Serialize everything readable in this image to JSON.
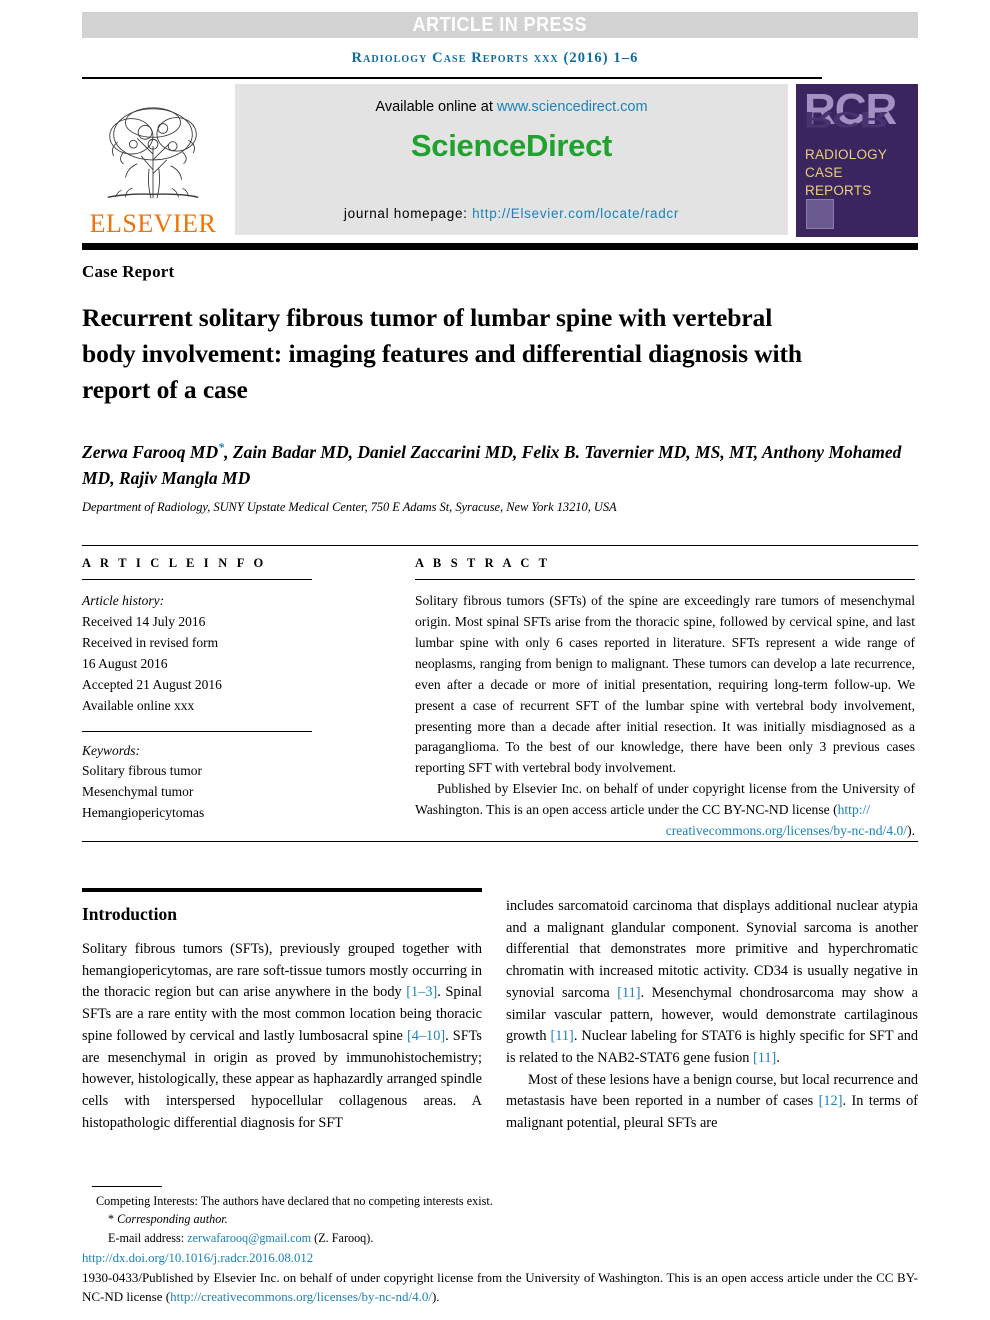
{
  "banner": {
    "text": "ARTICLE IN PRESS",
    "bg_color": "#d2d2d2",
    "text_color": "#ffffff"
  },
  "running_head": "Radiology Case Reports xxx (2016) 1–6",
  "masthead": {
    "publisher_name": "ELSEVIER",
    "publisher_color": "#ec7404",
    "available_label": "Available online at",
    "available_url": "www.sciencedirect.com",
    "sciencedirect_logo": "ScienceDirect",
    "sciencedirect_color": "#1fa22e",
    "homepage_label": "journal homepage:",
    "homepage_url": "http://Elsevier.com/locate/radcr",
    "link_color": "#2a79b5",
    "cover": {
      "acronym": "RCR",
      "line1": "RADIOLOGY",
      "line2": "CASE",
      "line3": "REPORTS",
      "bg_color": "#3b255f",
      "acronym_color": "#a491c4",
      "title_color": "#e8d07a"
    }
  },
  "article": {
    "type_label": "Case Report",
    "title": "Recurrent solitary fibrous tumor of lumbar spine with vertebral body involvement: imaging features and differential diagnosis with report of a case",
    "authors": "Zerwa Farooq MD",
    "authors_rest": ", Zain Badar MD, Daniel Zaccarini MD, Felix B. Tavernier MD, MS, MT, Anthony Mohamed MD, Rajiv Mangla MD",
    "corresponding_marker": "*",
    "affiliation": "Department of Radiology, SUNY Upstate Medical Center, 750 E Adams St, Syracuse, New York 13210, USA"
  },
  "article_info": {
    "heading": "A R T I C L E   I N F O",
    "history_label": "Article history:",
    "received": "Received 14 July 2016",
    "revised_label": "Received in revised form",
    "revised_date": "16 August 2016",
    "accepted": "Accepted 21 August 2016",
    "available_online": "Available online xxx",
    "keywords_label": "Keywords:",
    "keywords": [
      "Solitary fibrous tumor",
      "Mesenchymal tumor",
      "Hemangiopericytomas"
    ]
  },
  "abstract": {
    "heading": "A B S T R A C T",
    "body": "Solitary fibrous tumors (SFTs) of the spine are exceedingly rare tumors of mesenchymal origin. Most spinal SFTs arise from the thoracic spine, followed by cervical spine, and last lumbar spine with only 6 cases reported in literature. SFTs represent a wide range of neoplasms, ranging from benign to malignant. These tumors can develop a late recurrence, even after a decade or more of initial presentation, requiring long-term follow-up. We present a case of recurrent SFT of the lumbar spine with vertebral body involvement, presenting more than a decade after initial resection. It was initially misdiagnosed as a paraganglioma. To the best of our knowledge, there have been only 3 previous cases reporting SFT with vertebral body involvement.",
    "published_text": "Published by Elsevier Inc. on behalf of under copyright license from the University of Washington. This is an open access article under the CC BY-NC-ND license (",
    "license_url_part1": "http://",
    "license_url_part2": "creativecommons.org/licenses/by-nc-nd/4.0/",
    "published_tail": ")."
  },
  "introduction": {
    "heading": "Introduction",
    "left_paragraph_part1": "Solitary fibrous tumors (SFTs), previously grouped together with hemangiopericytomas, are rare soft-tissue tumors mostly occurring in the thoracic region but can arise anywhere in the body ",
    "ref_1_3": "[1–3]",
    "left_paragraph_part2": ". Spinal SFTs are a rare entity with the most common location being thoracic spine followed by cervical and lastly lumbosacral spine ",
    "ref_4_10": "[4–10]",
    "left_paragraph_part3": ". SFTs are mesenchymal in origin as proved by immunohistochemistry; however, histologically, these appear as haphazardly arranged spindle cells with interspersed hypocellular collagenous areas. A histopathologic differential diagnosis for SFT",
    "right_paragraph_part1": "includes sarcomatoid carcinoma that displays additional nuclear atypia and a malignant glandular component. Synovial sarcoma is another differential that demonstrates more primitive and hyperchromatic chromatin with increased mitotic activity. CD34 is usually negative in synovial sarcoma ",
    "ref_11_a": "[11]",
    "right_paragraph_part2": ". Mesenchymal chondrosarcoma may show a similar vascular pattern, however, would demonstrate cartilaginous growth ",
    "ref_11_b": "[11]",
    "right_paragraph_part3": ". Nuclear labeling for STAT6 is highly specific for SFT and is related to the NAB2-STAT6 gene fusion ",
    "ref_11_c": "[11]",
    "right_paragraph_part4": ".",
    "right_paragraph2_part1": "Most of these lesions have a benign course, but local recurrence and metastasis have been reported in a number of cases ",
    "ref_12": "[12]",
    "right_paragraph2_part2": ". In terms of malignant potential, pleural SFTs are"
  },
  "footnotes": {
    "competing_interests": "Competing Interests: The authors have declared that no competing interests exist.",
    "corresponding_author": "Corresponding author.",
    "email_label": "E-mail address:",
    "email": "zerwafarooq@gmail.com",
    "email_attrib": "(Z. Farooq).",
    "doi": "http://dx.doi.org/10.1016/j.radcr.2016.08.012",
    "copyright_part1": "1930-0433/Published by Elsevier Inc. on behalf of under copyright license from the University of Washington. This is an open access article under the CC BY-NC-ND license (",
    "copyright_link": "http://creativecommons.org/licenses/by-nc-nd/4.0/",
    "copyright_part2": ")."
  },
  "colors": {
    "link": "#1c82b8",
    "journal_head": "#0f6ca0",
    "elsevier_orange": "#ec7404",
    "sciencedirect_green": "#1fa22e"
  }
}
